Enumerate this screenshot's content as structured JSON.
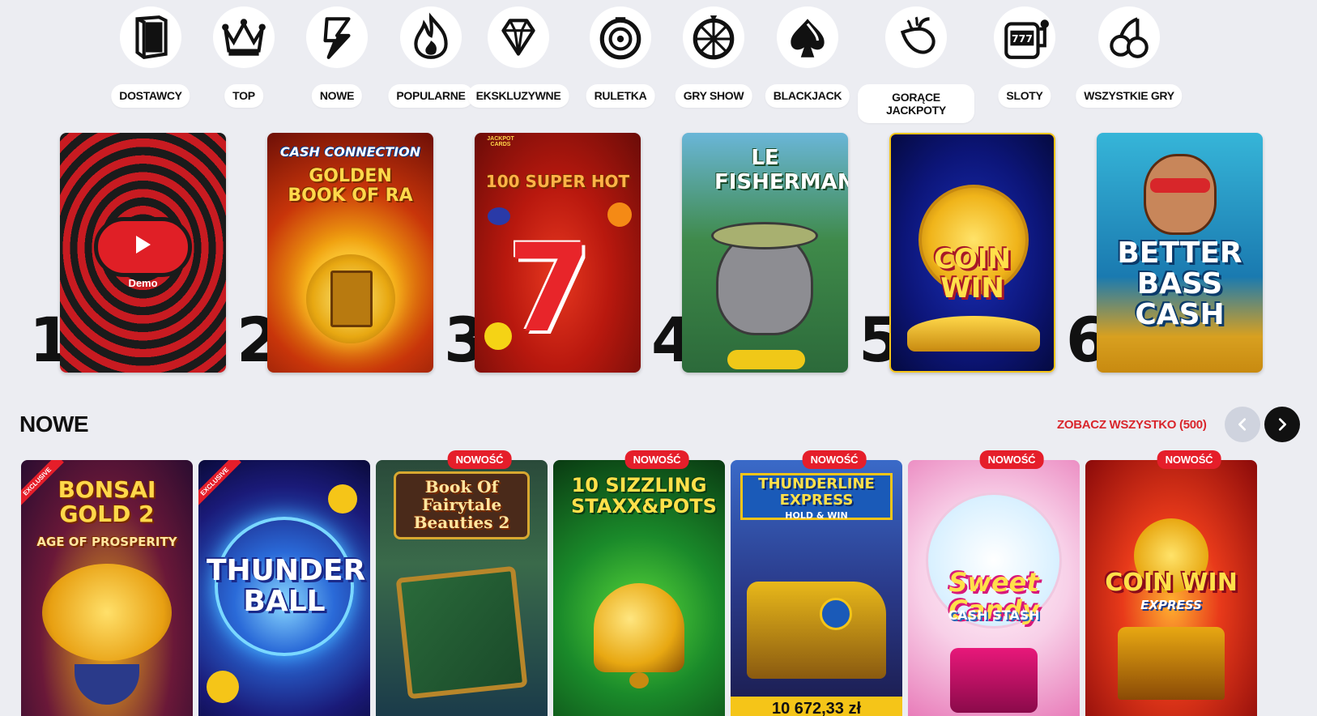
{
  "categories": [
    {
      "label": "DOSTAWCY",
      "icon": "book-icon"
    },
    {
      "label": "TOP",
      "icon": "crown-icon"
    },
    {
      "label": "NOWE",
      "icon": "lightning-icon"
    },
    {
      "label": "POPULARNE",
      "icon": "flame-icon"
    },
    {
      "label": "EKSKLUZYWNE",
      "icon": "diamond-icon"
    },
    {
      "label": "RULETKA",
      "icon": "roulette-icon"
    },
    {
      "label": "GRY SHOW",
      "icon": "wheel-icon"
    },
    {
      "label": "BLACKJACK",
      "icon": "spade-icon"
    },
    {
      "label": "GORĄCE JACKPOTY",
      "icon": "hot-pepper-icon"
    },
    {
      "label": "SLOTY",
      "icon": "slot-machine-icon"
    },
    {
      "label": "WSZYSTKIE GRY",
      "icon": "cherries-icon"
    }
  ],
  "top_games": [
    {
      "rank": "1",
      "title": "",
      "demo_label": "Demo"
    },
    {
      "rank": "2",
      "title": "GOLDEN BOOK OF RA",
      "subtitle": "CASH CONNECTION"
    },
    {
      "rank": "3",
      "title": "100 SUPER HOT",
      "subtitle": "JACKPOT CARDS"
    },
    {
      "rank": "4",
      "title": "LE FISHERMAN"
    },
    {
      "rank": "5",
      "title": "COIN WIN"
    },
    {
      "rank": "6",
      "title": "BETTER BASS CASH"
    }
  ],
  "new_section": {
    "title": "NOWE",
    "see_all": "ZOBACZ WSZYSTKO (500)",
    "prev_icon": "chevron-left-icon",
    "next_icon": "chevron-right-icon"
  },
  "new_games": [
    {
      "title": "BONSAI GOLD 2",
      "subtitle": "AGE OF PROSPERITY",
      "badge": "",
      "exclusive": "EXCLUSIVE"
    },
    {
      "title": "THUNDER BALL",
      "badge": "",
      "exclusive": "EXCLUSIVE"
    },
    {
      "title": "Book Of Fairytale Beauties 2",
      "badge": "NOWOŚĆ"
    },
    {
      "title": "10 SIZZLING STAXX&POTS",
      "badge": "NOWOŚĆ"
    },
    {
      "title": "THUNDERLINE EXPRESS",
      "subtitle": "HOLD & WIN",
      "badge": "NOWOŚĆ",
      "jackpot": "10 672,33 zł"
    },
    {
      "title": "Sweet Candy",
      "subtitle": "CASH STASH",
      "badge": "NOWOŚĆ"
    },
    {
      "title": "COIN WIN",
      "subtitle": "EXPRESS",
      "badge": "NOWOŚĆ"
    }
  ],
  "colors": {
    "accent_red": "#e51e2a",
    "link_red": "#d9262c",
    "background": "#ecedf2"
  }
}
